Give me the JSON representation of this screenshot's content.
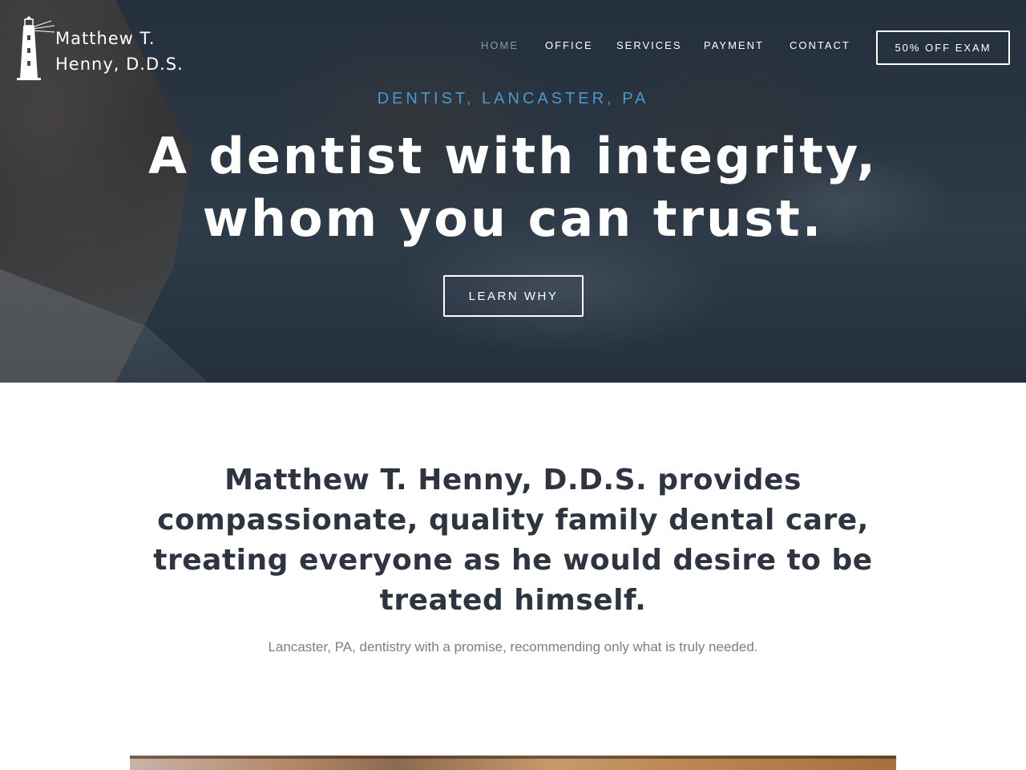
{
  "brand": {
    "line1": "Matthew T.",
    "line2": "Henny, D.D.S.",
    "icon": "lighthouse-icon"
  },
  "nav": {
    "items": [
      {
        "label": "HOME",
        "active": true
      },
      {
        "label": "OFFICE",
        "active": false
      },
      {
        "label": "SERVICES",
        "active": false
      },
      {
        "label": "PAYMENT",
        "active": false
      },
      {
        "label": "CONTACT",
        "active": false
      }
    ],
    "cta": "50% OFF EXAM"
  },
  "hero": {
    "kicker": "DENTIST, LANCASTER, PA",
    "title_line1": "A dentist with integrity,",
    "title_line2": "whom you can trust.",
    "button": "LEARN WHY"
  },
  "intro": {
    "headline_lines": [
      "Matthew T. Henny, D.D.S. provides",
      "compassionate, quality family dental care,",
      "treating everyone as he would desire to be",
      "treated himself."
    ],
    "subtext": "Lancaster, PA, dentistry with a promise, recommending only what is truly needed."
  },
  "colors": {
    "accent": "#4b98cf",
    "nav_active": "#8b98aa",
    "heading_text": "#2e3440",
    "muted_text": "#7a7f86"
  }
}
